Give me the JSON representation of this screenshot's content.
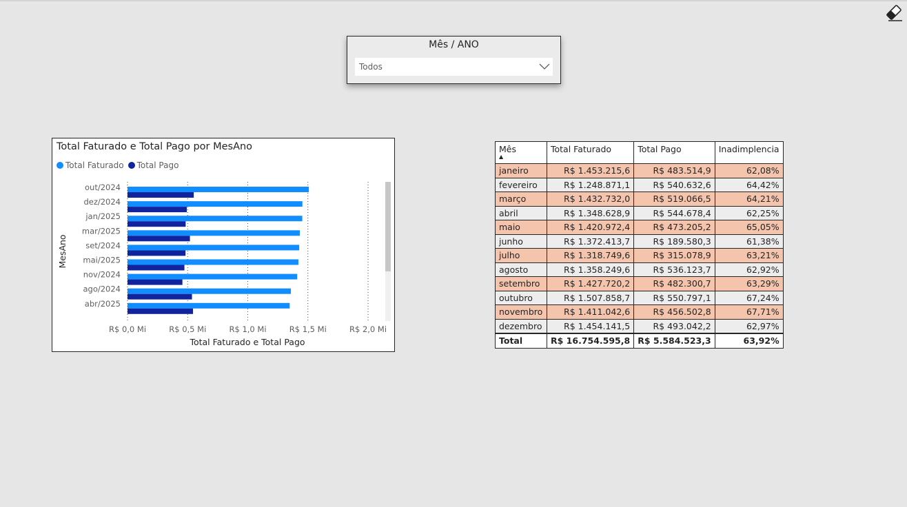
{
  "slicer": {
    "title": "Mês / ANO",
    "selected": "Todos"
  },
  "chart_data": {
    "type": "bar",
    "orientation": "horizontal",
    "title": "Total Faturado e Total Pago por MesAno",
    "xlabel": "Total Faturado e Total Pago",
    "ylabel": "MesAno",
    "categories": [
      "out/2024",
      "dez/2024",
      "jan/2025",
      "mar/2025",
      "set/2024",
      "mai/2025",
      "nov/2024",
      "ago/2024",
      "abr/2025"
    ],
    "series": [
      {
        "name": "Total Faturado",
        "color": "#118dff",
        "values": [
          1507858.7,
          1454141.5,
          1453215.6,
          1432732.0,
          1427720.2,
          1420972.4,
          1411042.6,
          1358249.6,
          1348628.9
        ]
      },
      {
        "name": "Total Pago",
        "color": "#12239e",
        "values": [
          550797.1,
          493042.2,
          483514.9,
          519066.5,
          482300.7,
          473205.2,
          456502.8,
          536123.7,
          544678.4
        ]
      }
    ],
    "xlim": [
      0,
      2000000
    ],
    "xticks": [
      "R$ 0,0 Mi",
      "R$ 0,5 Mi",
      "R$ 1,0 Mi",
      "R$ 1,5 Mi",
      "R$ 2,0 Mi"
    ],
    "legend": "top-left",
    "grid": true
  },
  "table": {
    "headers": [
      "Mês",
      "Total Faturado",
      "Total Pago",
      "Inadimplencia"
    ],
    "rows": [
      [
        "janeiro",
        "R$ 1.453.215,6",
        "R$ 483.514,9",
        "62,08%"
      ],
      [
        "fevereiro",
        "R$ 1.248.871,1",
        "R$ 540.632,6",
        "64,42%"
      ],
      [
        "março",
        "R$ 1.432.732,0",
        "R$ 519.066,5",
        "64,21%"
      ],
      [
        "abril",
        "R$ 1.348.628,9",
        "R$ 544.678,4",
        "62,25%"
      ],
      [
        "maio",
        "R$ 1.420.972,4",
        "R$ 473.205,2",
        "65,05%"
      ],
      [
        "junho",
        "R$ 1.372.413,7",
        "R$ 189.580,3",
        "61,38%"
      ],
      [
        "julho",
        "R$ 1.318.749,6",
        "R$ 315.078,9",
        "63,21%"
      ],
      [
        "agosto",
        "R$ 1.358.249,6",
        "R$ 536.123,7",
        "62,92%"
      ],
      [
        "setembro",
        "R$ 1.427.720,2",
        "R$ 482.300,7",
        "63,29%"
      ],
      [
        "outubro",
        "R$ 1.507.858,7",
        "R$ 550.797,1",
        "67,24%"
      ],
      [
        "novembro",
        "R$ 1.411.042,6",
        "R$ 456.502,8",
        "67,71%"
      ],
      [
        "dezembro",
        "R$ 1.454.141,5",
        "R$ 493.042,2",
        "62,97%"
      ]
    ],
    "total": [
      "Total",
      "R$ 16.754.595,8",
      "R$ 5.584.523,3",
      "63,92%"
    ],
    "row_highlight_color": "#f4c4ad"
  },
  "icons": {
    "clear_filters": "eraser-icon",
    "dropdown": "chevron-down-icon"
  }
}
